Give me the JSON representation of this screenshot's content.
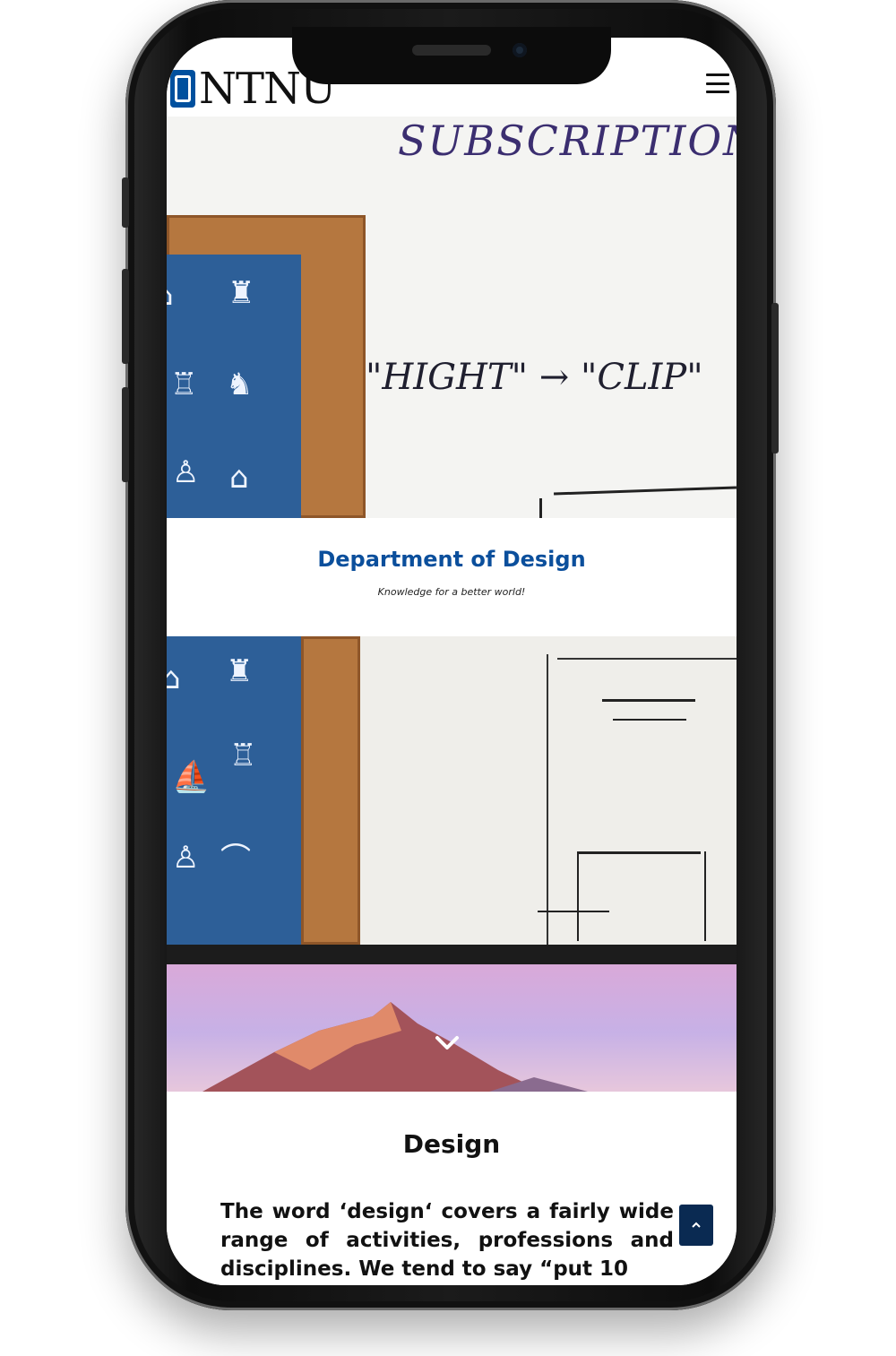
{
  "header": {
    "logo_text": "NTNU",
    "menu_icon": "hamburger-menu-icon"
  },
  "hero": {
    "board_text_top": "SUBSCRIPTION",
    "board_text_mid": "\"HIGHT\" → \"CLIP\""
  },
  "department": {
    "title": "Department of Design",
    "tagline": "Knowledge for a better world!"
  },
  "scroll_icon": "chevron-down-icon",
  "section": {
    "title": "Design",
    "body": "The word ‘design‘ covers a fairly wide range of activities, professions and disciplines. We tend to say “put 10"
  },
  "back_to_top_icon": "caret-up-icon",
  "colors": {
    "brand_blue": "#00509e",
    "title_blue": "#0b4f9c",
    "back_to_top": "#0a2a52"
  }
}
